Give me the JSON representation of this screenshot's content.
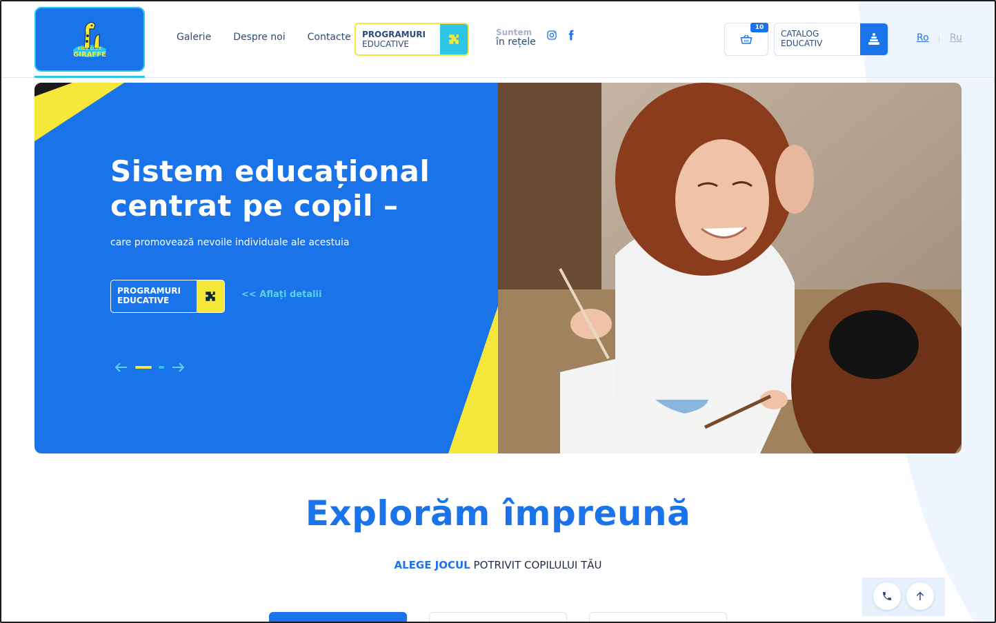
{
  "header": {
    "logo_text_top": "KIDS CLUB",
    "logo_text_main": "GIRAFFE",
    "nav": [
      "Galerie",
      "Despre noi",
      "Contacte"
    ],
    "programs_button": {
      "line1": "PROGRAMURI",
      "line2": "EDUCATIVE",
      "icon": "puzzle-icon"
    },
    "social": {
      "label1": "Suntem",
      "label2": "în rețele",
      "icons": [
        "instagram-icon",
        "facebook-icon"
      ]
    },
    "cart": {
      "count": "10",
      "icon": "basket-icon"
    },
    "catalog_button": {
      "line1": "CATALOG",
      "line2": "EDUCATIV",
      "icon": "pyramid-toy-icon"
    },
    "languages": {
      "active": "Ro",
      "other": "Ru"
    }
  },
  "hero": {
    "title": "Sistem educațional centrat pe copil –",
    "subtitle": "care promovează nevoile individuale ale acestuia",
    "button": {
      "line1": "PROGRAMURI",
      "line2": "EDUCATIVE"
    },
    "link": "<< Aflați detalii",
    "slides_total": 2,
    "active_slide": 1
  },
  "section": {
    "title": "Explorăm împreună",
    "subtitle_highlight": "ALEGE JOCUL",
    "subtitle_rest": " POTRIVIT COPILULUI TĂU"
  },
  "colors": {
    "primary": "#1a73e8",
    "accent_yellow": "#f6e83a",
    "accent_cyan": "#2ec4e6"
  }
}
